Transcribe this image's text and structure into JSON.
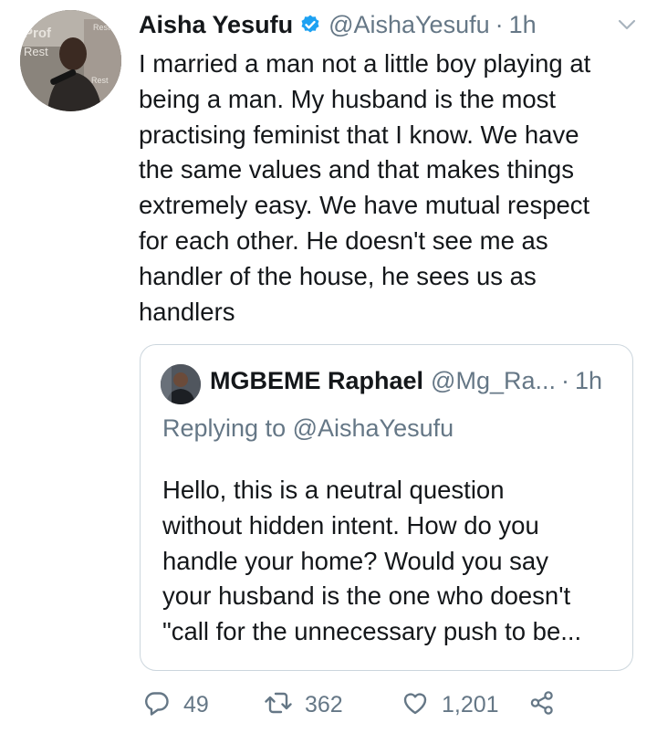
{
  "tweet": {
    "author_name": "Aisha Yesufu",
    "author_handle": "@AishaYesufu",
    "separator": "·",
    "time": "1h",
    "text": "I married a man not a little boy playing at\nbeing a man. My husband is the most\npractising feminist that I know. We have\nthe same values and that makes things\nextremely easy. We have mutual respect\nfor each other. He doesn't see me as\nhandler of the house, he sees us as\nhandlers",
    "avatar_text": "Rest Prof Rest Peace"
  },
  "quoted": {
    "author_name": "MGBEME Raphael",
    "author_handle": "@Mg_Ra...",
    "separator": "·",
    "time": "1h",
    "replying_label": "Replying to",
    "replying_handle": "@AishaYesufu",
    "text": "Hello, this is a neutral question\nwithout hidden intent. How do you\nhandle your home? Would you say\nyour husband is the one who doesn't\n\"call for the unnecessary push to be..."
  },
  "actions": {
    "reply_count": "49",
    "retweet_count": "362",
    "like_count": "1,201"
  },
  "colors": {
    "text": "#14171a",
    "secondary": "#657786",
    "verified": "#1da1f2",
    "border": "#ccd6dd"
  },
  "icons": [
    "verified-badge-icon",
    "chevron-down-icon",
    "reply-icon",
    "retweet-icon",
    "like-icon",
    "share-icon"
  ]
}
